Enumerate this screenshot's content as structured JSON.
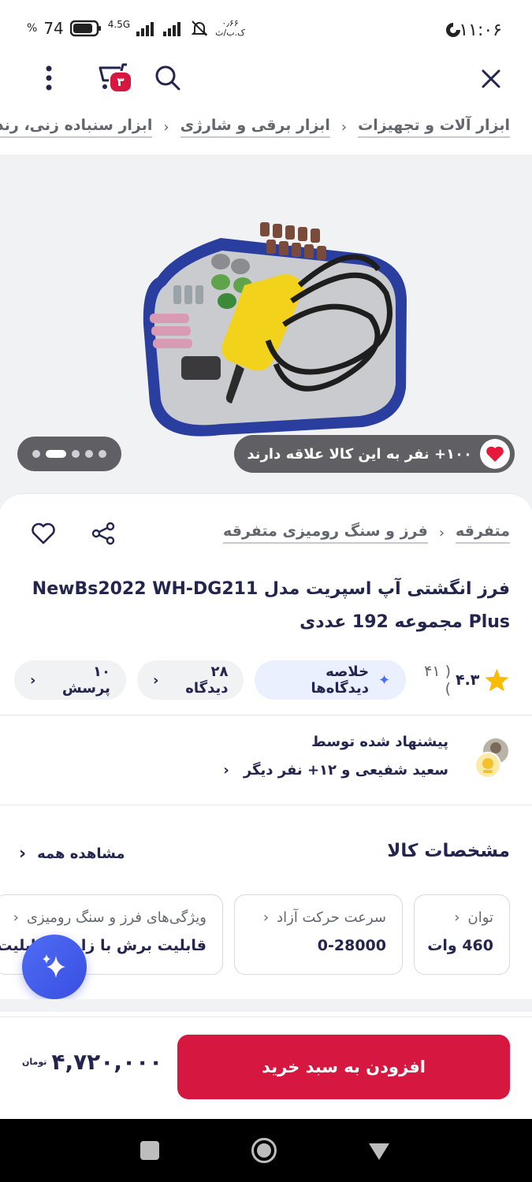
{
  "status_bar": {
    "time": "۱۱:۰۶",
    "battery": "74",
    "battery_unit": "%",
    "network": "4.5G",
    "speed": "۰٫۶۶",
    "speed_unit": "ک.ب/ث"
  },
  "topbar": {
    "cart_count": "۳",
    "icons": [
      "close-icon",
      "search-icon",
      "cart-icon",
      "more-icon"
    ]
  },
  "breadcrumb": {
    "items": [
      "ابزار آلات و تجهیزات",
      "ابزار برقی و شارژی",
      "ابزار سنباده زنی، رنده و پولیش"
    ]
  },
  "gallery": {
    "likes_text": "۱۰۰+ نفر به این کالا علاقه دارند",
    "dots": 5,
    "active_dot": 1
  },
  "product": {
    "sub_crumbs": [
      "متفرقه",
      "فرز و سنگ رومیزی متفرقه"
    ],
    "title": "فرز انگشتی آپ اسپریت مدل NewBs2022 WH-DG211 Plus مجموعه 192 عددی",
    "rating": "۴.۳",
    "rating_count": "( ۴۱ )",
    "review_summary": "خلاصه دیدگاه‌ها",
    "views": "۲۸ دیدگاه",
    "questions": "۱۰ پرسش"
  },
  "suggest": {
    "line1": "پیشنهاد شده توسط",
    "line2": "سعید شفیعی و ۱۲+ نفر دیگر"
  },
  "specs": {
    "heading": "مشخصات کالا",
    "see_all": "مشاهده همه",
    "items": [
      {
        "key": "توان",
        "value": "460 وات"
      },
      {
        "key": "سرعت حرکت آزاد",
        "value": "0-28000"
      },
      {
        "key": "ویژگی‌های فرز و سنگ رومیزی",
        "value": "قابلیت برش با زاویه، قابلیت ب"
      }
    ]
  },
  "footer": {
    "add_to_cart": "افزودن به سبد خرید",
    "price": "۴,۷۲۰,۰۰۰",
    "currency": "تومان"
  },
  "colors": {
    "brand": "#d6173f",
    "text": "#23254e",
    "accent_blue": "#4f6cf6",
    "star": "#f9bc00"
  }
}
